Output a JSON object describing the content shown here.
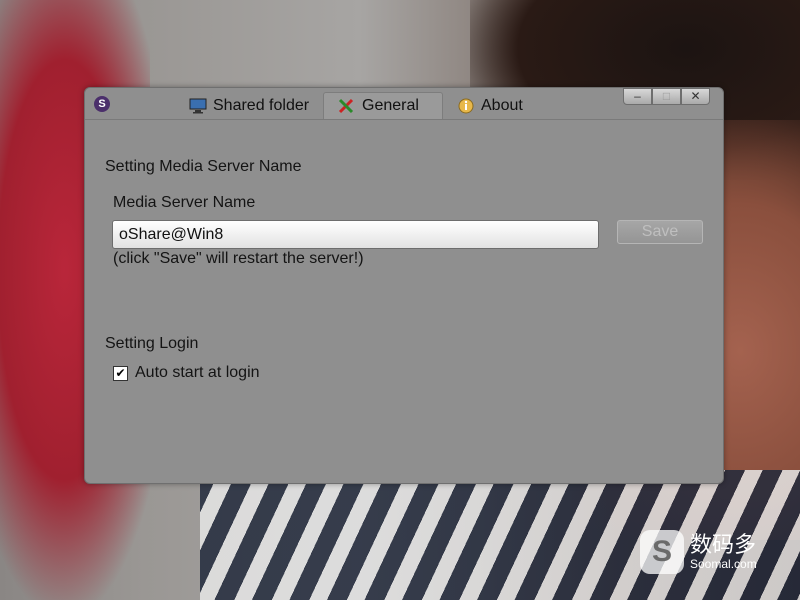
{
  "app": {
    "icon_letter": "S"
  },
  "tabs": [
    {
      "label": "Shared folder",
      "icon": "monitor-icon",
      "active": false
    },
    {
      "label": "General",
      "icon": "tools-icon",
      "active": true
    },
    {
      "label": "About",
      "icon": "info-bulb-icon",
      "active": false
    }
  ],
  "window_buttons": {
    "minimize": "–",
    "maximize": "□",
    "close": "✕"
  },
  "general": {
    "server_section_title": "Setting Media Server Name",
    "server_name_label": "Media Server Name",
    "server_name_value": "oShare@Win8",
    "save_label": "Save",
    "restart_note": "(click \"Save\" will restart the server!)",
    "login_section_title": "Setting Login",
    "auto_start_label": "Auto start at login",
    "auto_start_checked": true
  },
  "watermark": {
    "logo_letter": "S",
    "cn": "数码多",
    "en": "Soomal.com"
  },
  "colors": {
    "window_bg": "#8f8f8f",
    "disabled_text": "#bfbfbf"
  }
}
